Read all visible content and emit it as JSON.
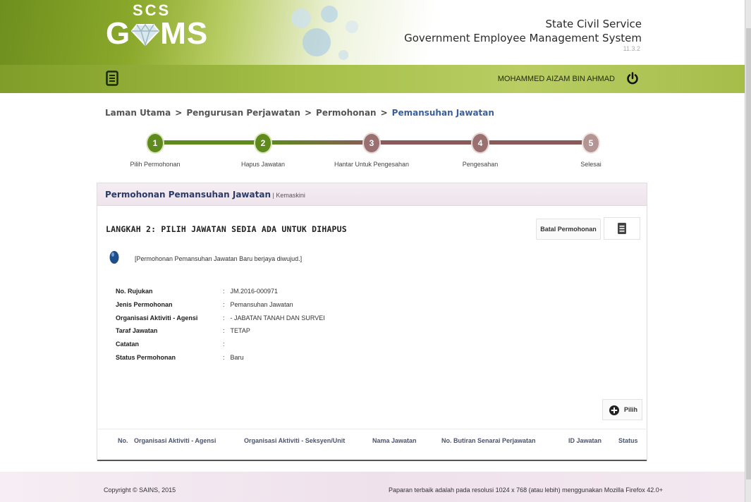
{
  "header": {
    "logo_top": "SCS",
    "logo_left": "G",
    "logo_right": "MS",
    "title_line1": "State Civil Service",
    "title_line2": "Government Employee Management System",
    "version": "11.3.2"
  },
  "navbar": {
    "menu_icon": "document-menu-icon",
    "user_name": "MOHAMMED AIZAM BIN AHMAD",
    "logout_icon": "power-icon"
  },
  "breadcrumb": {
    "items": [
      "Laman Utama",
      "Pengurusan Perjawatan",
      "Permohonan"
    ],
    "separator": ">",
    "current": "Pemansuhan Jawatan"
  },
  "stepper": {
    "current_step": 2,
    "steps": [
      {
        "num": "1",
        "label": "Pilih Permohonan",
        "state": "done"
      },
      {
        "num": "2",
        "label": "Hapus Jawatan",
        "state": "active"
      },
      {
        "num": "3",
        "label": "Hantar Untuk Pengesahan",
        "state": "pending"
      },
      {
        "num": "4",
        "label": "Pengesahan",
        "state": "pending"
      },
      {
        "num": "5",
        "label": "Selesai",
        "state": "pending"
      }
    ]
  },
  "panel": {
    "title": "Permohonan Pemansuhan Jawatan",
    "title_sep": " | ",
    "subtitle": "Kemaskini",
    "step_title": "LANGKAH 2: PILIH JAWATAN SEDIA ADA UNTUK DIHAPUS",
    "cancel_label": "Batal Permohonan",
    "info_text": "[Permohonan Pemansuhan Jawatan Baru berjaya diwujud.]",
    "details": [
      {
        "label": "No. Rujukan",
        "value": "JM.2016-000971"
      },
      {
        "label": "Jenis Permohonan",
        "value": "Pemansuhan Jawatan"
      },
      {
        "label": "Organisasi Aktiviti - Agensi",
        "value": "- JABATAN TANAH DAN SURVEI"
      },
      {
        "label": "Taraf Jawatan",
        "value": "TETAP"
      },
      {
        "label": "Catatan",
        "value": ""
      },
      {
        "label": "Status Permohonan",
        "value": "Baru"
      }
    ],
    "pilih_label": "Pilih",
    "table_headers": [
      "No.",
      "Organisasi Aktiviti - Agensi",
      "Organisasi Aktiviti - Seksyen/Unit",
      "Nama Jawatan",
      "No. Butiran Senarai Perjawatan",
      "ID Jawatan",
      "Status"
    ]
  },
  "footer": {
    "copyright": "Copyright © SAINS, 2015",
    "resolution": "Paparan terbaik adalah pada resolusi 1024 x 768 (atau lebih) menggunakan Mozilla Firefox 42.0+"
  },
  "colors": {
    "brand_green": "#7f9d28",
    "step_done": "#5e8a1e",
    "step_pending": "#8a5a58",
    "breadcrumb_current": "#3a5f9a"
  }
}
